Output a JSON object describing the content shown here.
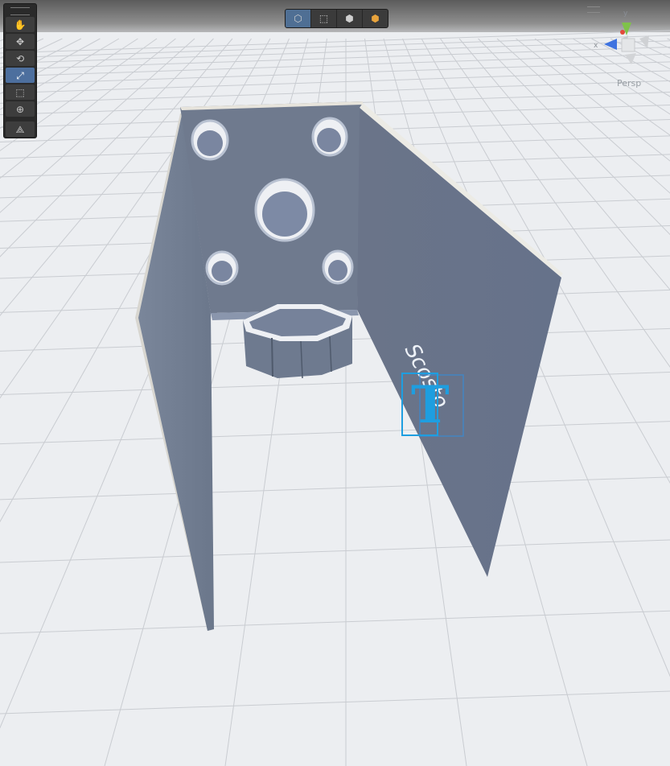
{
  "viewport": {
    "projection_label": "Persp",
    "gizmo_axes": {
      "y": "y",
      "x": "x"
    },
    "wall_text": "Scosto",
    "text_gizmo_glyph": "T",
    "colors": {
      "wall": "#6f7a8e",
      "grid_line": "#c9ccd1",
      "ground": "#eceef1",
      "selection_blue": "#1e9ee0"
    }
  },
  "tools_panel": {
    "tools": [
      {
        "name": "hand-tool",
        "icon": "hand-icon",
        "glyph": "✋",
        "active": false
      },
      {
        "name": "move-tool",
        "icon": "move-icon",
        "glyph": "✥",
        "active": false
      },
      {
        "name": "rotate-tool",
        "icon": "rotate-icon",
        "glyph": "⟲",
        "active": false
      },
      {
        "name": "scale-tool",
        "icon": "scale-icon",
        "glyph": "⤢",
        "active": true
      },
      {
        "name": "rect-tool",
        "icon": "rect-transform-icon",
        "glyph": "⬚",
        "active": false
      },
      {
        "name": "transform-tool",
        "icon": "transform-icon",
        "glyph": "⊕",
        "active": false
      },
      {
        "name": "custom-tool",
        "icon": "custom-tool-icon",
        "glyph": "⟁",
        "active": false
      }
    ]
  },
  "view_toolbar": {
    "buttons": [
      {
        "name": "view-3d-button",
        "icon": "cube-outline-icon",
        "glyph": "⬡",
        "active": true
      },
      {
        "name": "view-rect-button",
        "icon": "rect-select-icon",
        "glyph": "⬚",
        "active": false
      },
      {
        "name": "view-shaded-button",
        "icon": "cube-shaded-icon",
        "glyph": "⬢",
        "active": false
      },
      {
        "name": "view-orange-button",
        "icon": "cube-orange-icon",
        "glyph": "⬢",
        "active": false
      }
    ]
  }
}
